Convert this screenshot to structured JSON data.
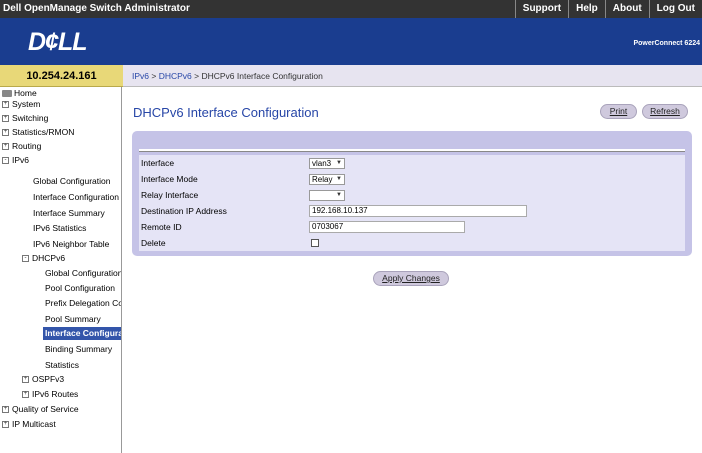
{
  "header": {
    "app_title": "Dell OpenManage Switch Administrator",
    "nav": [
      "Support",
      "Help",
      "About",
      "Log Out"
    ],
    "logo": "D¢LL",
    "model": "PowerConnect 6224"
  },
  "ip_address": "10.254.24.161",
  "breadcrumb": {
    "items": [
      "IPv6",
      "DHCPv6",
      "DHCPv6 Interface Configuration"
    ],
    "separator": " > "
  },
  "sidebar": {
    "items": [
      {
        "label": "Home",
        "icon": "home-icon"
      },
      {
        "label": "System",
        "toggle": "+"
      },
      {
        "label": "Switching",
        "toggle": "+"
      },
      {
        "label": "Statistics/RMON",
        "toggle": "+"
      },
      {
        "label": "Routing",
        "toggle": "+"
      },
      {
        "label": "IPv6",
        "toggle": "-"
      },
      {
        "label": "Global Configuration"
      },
      {
        "label": "Interface Configuration"
      },
      {
        "label": "Interface Summary"
      },
      {
        "label": "IPv6 Statistics"
      },
      {
        "label": "IPv6 Neighbor Table"
      },
      {
        "label": "DHCPv6",
        "toggle": "-"
      },
      {
        "label": "Global Configuration"
      },
      {
        "label": "Pool Configuration"
      },
      {
        "label": "Prefix Delegation Configuration"
      },
      {
        "label": "Pool Summary"
      },
      {
        "label": "Interface Configuration",
        "selected": true
      },
      {
        "label": "Binding Summary"
      },
      {
        "label": "Statistics"
      },
      {
        "label": "OSPFv3",
        "toggle": "+"
      },
      {
        "label": "IPv6 Routes",
        "toggle": "+"
      },
      {
        "label": "Quality of Service",
        "toggle": "+"
      },
      {
        "label": "IP Multicast",
        "toggle": "+"
      }
    ]
  },
  "main": {
    "title": "DHCPv6 Interface Configuration",
    "print_label": "Print",
    "refresh_label": "Refresh",
    "apply_label": "Apply Changes",
    "fields": {
      "interface": {
        "label": "Interface",
        "value": "vlan3"
      },
      "mode": {
        "label": "Interface Mode",
        "value": "Relay"
      },
      "relay_interface": {
        "label": "Relay Interface",
        "value": ""
      },
      "dest_ip": {
        "label": "Destination IP Address",
        "value": "192.168.10.137"
      },
      "remote_id": {
        "label": "Remote ID",
        "value": "0703067"
      },
      "delete": {
        "label": "Delete",
        "checked": false
      }
    }
  },
  "colors": {
    "topbar": "#333333",
    "banner": "#1a3d8f",
    "accent": "#2746a7",
    "ip_box": "#e8d878",
    "panel": "#c5c3e7",
    "row": "#e5e4f6",
    "selected": "#3355aa"
  }
}
